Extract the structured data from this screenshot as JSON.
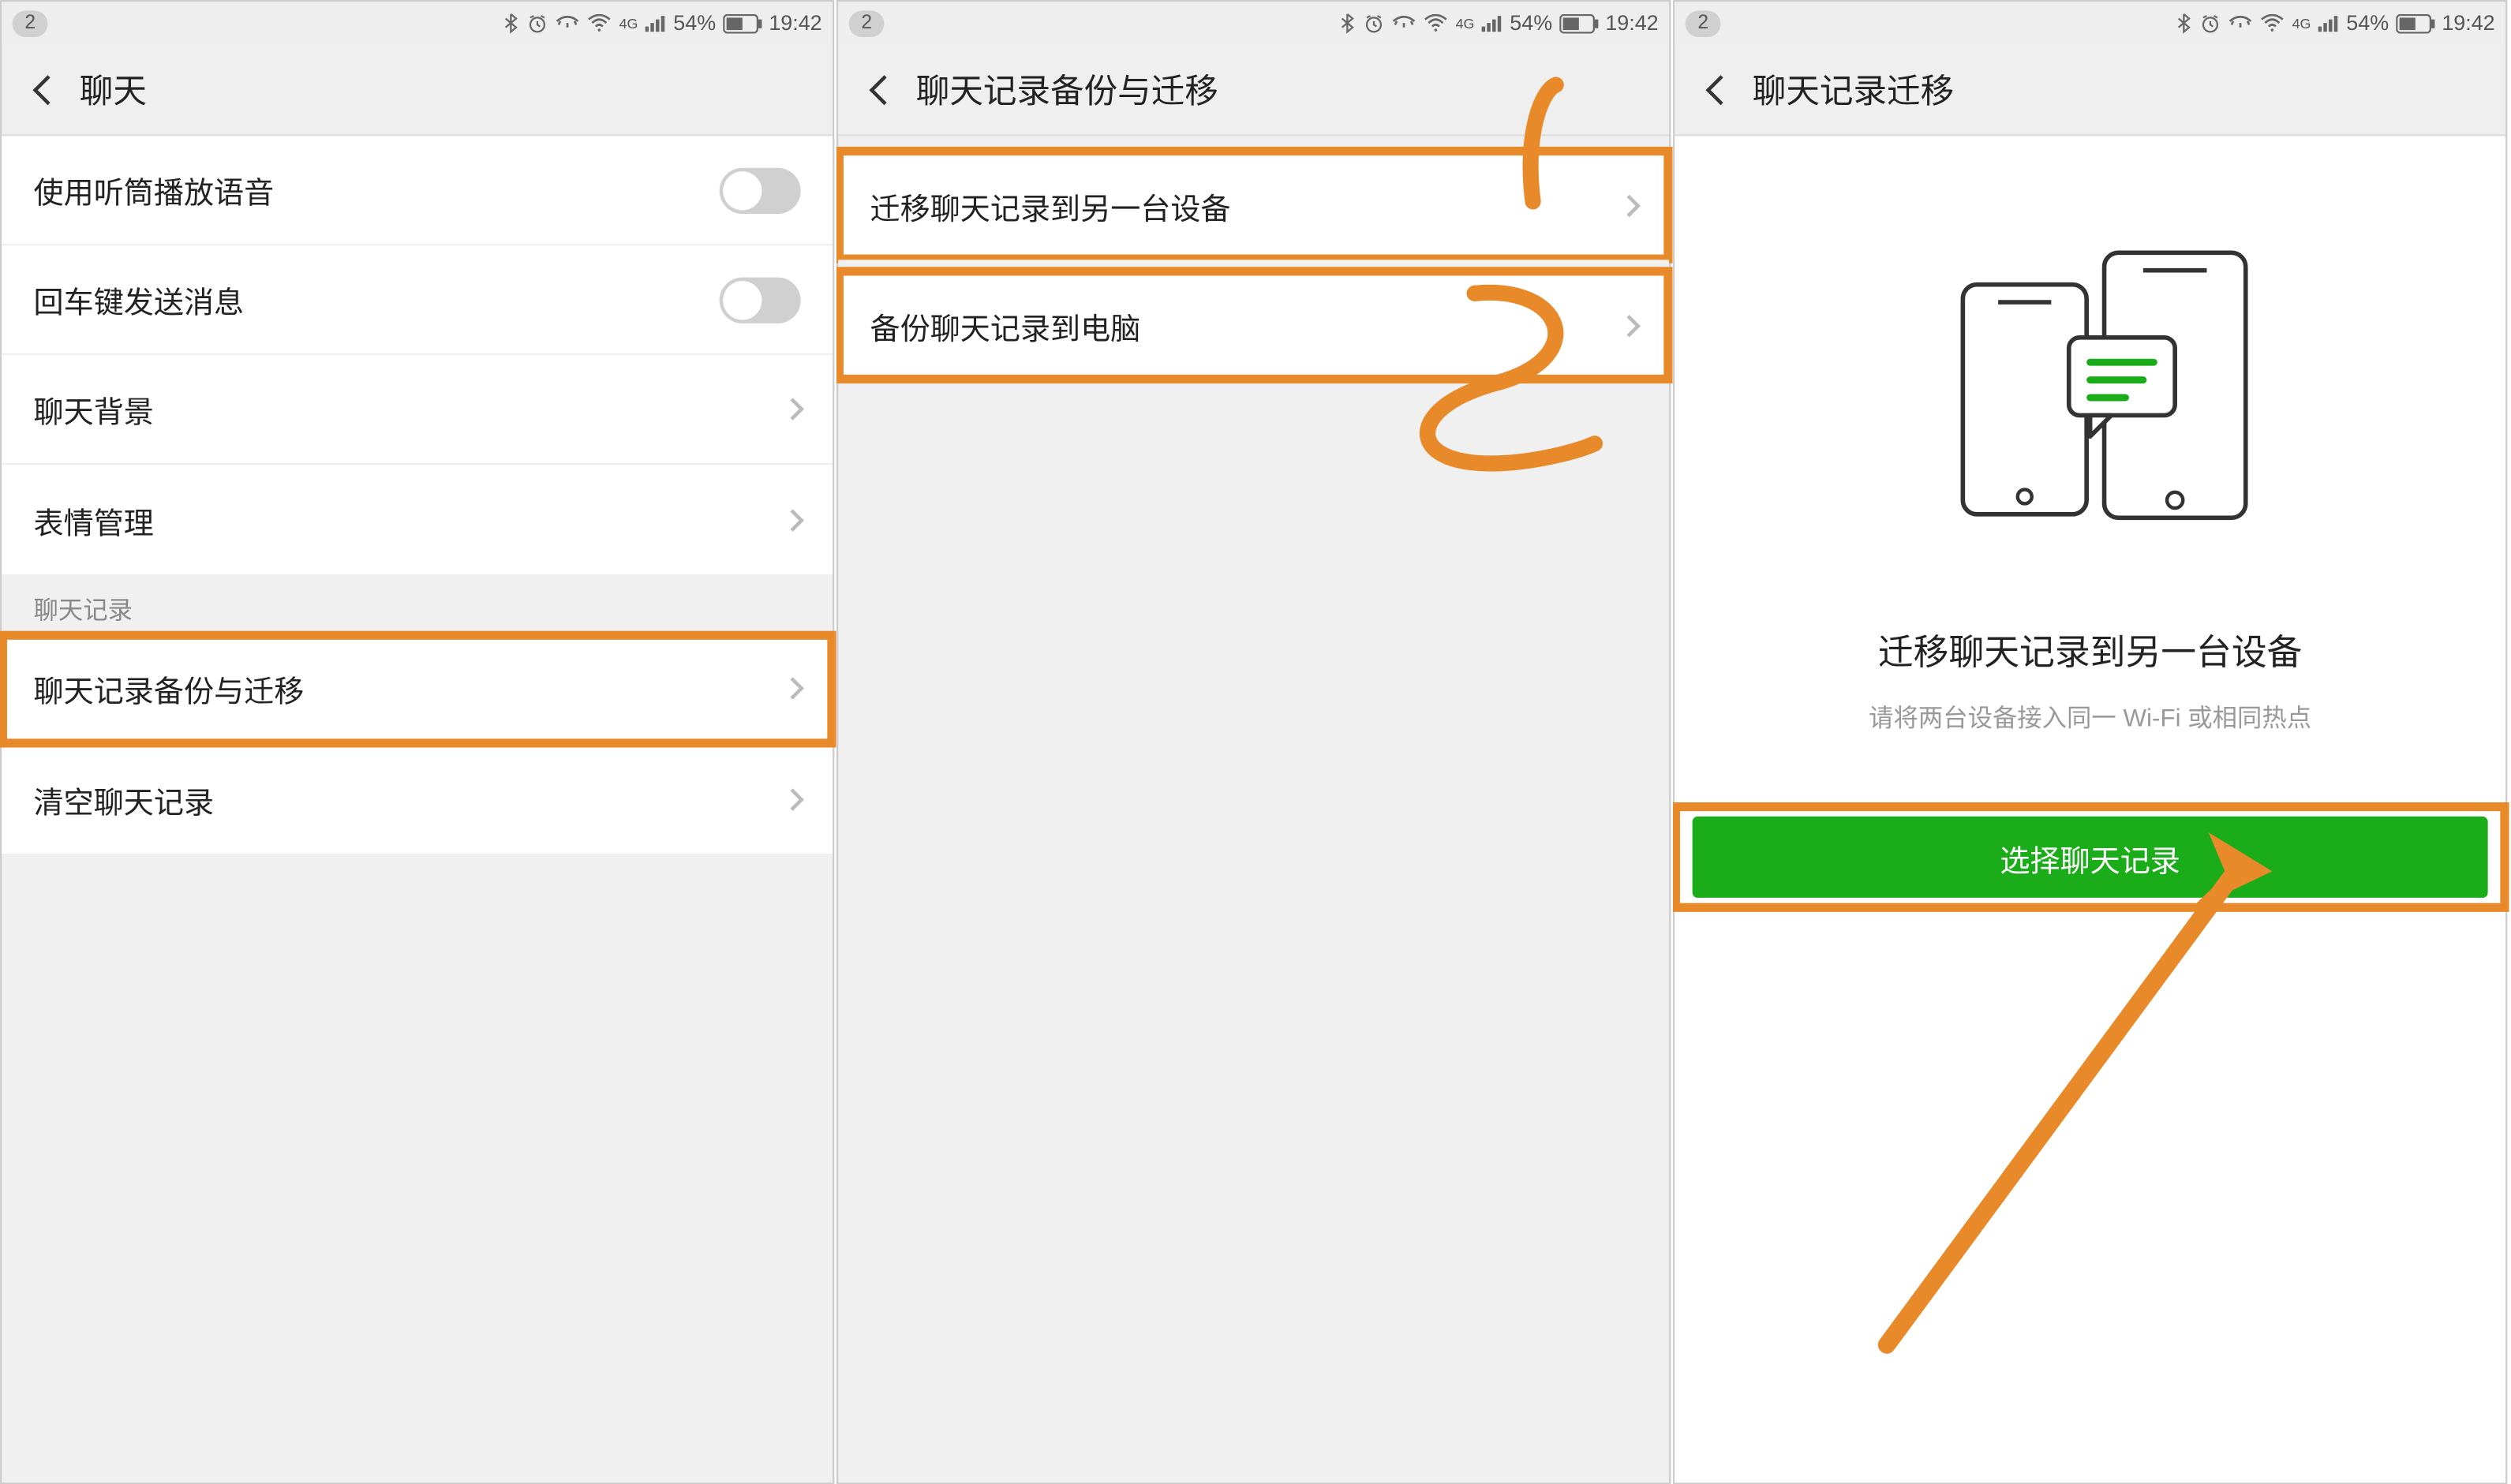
{
  "status_bar": {
    "notification_count": "2",
    "battery_text": "54%",
    "time": "19:42",
    "network_label": "4G"
  },
  "panel1": {
    "title": "聊天",
    "rows": {
      "earpiece": "使用听筒播放语音",
      "enter_send": "回车键发送消息",
      "chat_bg": "聊天背景",
      "sticker_mgr": "表情管理"
    },
    "section_header": "聊天记录",
    "rows2": {
      "backup_migrate": "聊天记录备份与迁移",
      "clear": "清空聊天记录"
    }
  },
  "panel2": {
    "title": "聊天记录备份与迁移",
    "rows": {
      "migrate_device": "迁移聊天记录到另一台设备",
      "backup_pc": "备份聊天记录到电脑"
    },
    "annotation1": "1",
    "annotation2": "2"
  },
  "panel3": {
    "title": "聊天记录迁移",
    "heading": "迁移聊天记录到另一台设备",
    "subtitle": "请将两台设备接入同一 Wi-Fi 或相同热点",
    "button": "选择聊天记录"
  }
}
